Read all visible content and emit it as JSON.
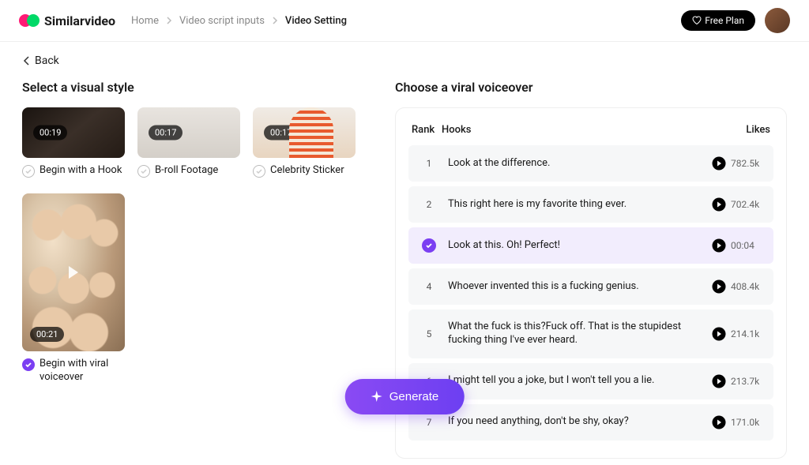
{
  "header": {
    "brand": "Similarvideo",
    "crumb_home": "Home",
    "crumb_inputs": "Video script inputs",
    "crumb_setting": "Video Setting",
    "free_plan": "Free Plan"
  },
  "back_label": "Back",
  "left": {
    "title": "Select a visual style",
    "styles": [
      {
        "duration": "00:19",
        "label": "Begin with a Hook"
      },
      {
        "duration": "00:17",
        "label": "B-roll Footage"
      },
      {
        "duration": "00:17",
        "label": "Celebrity Sticker"
      }
    ],
    "preview": {
      "duration": "00:21",
      "label": "Begin with viral voiceover"
    }
  },
  "right": {
    "title": "Choose a viral voiceover",
    "cols": {
      "rank": "Rank",
      "hooks": "Hooks",
      "likes": "Likes"
    },
    "rows": [
      {
        "rank": "1",
        "text": "Look at the difference.",
        "likes": "782.5k"
      },
      {
        "rank": "2",
        "text": "This right here is my favorite thing ever.",
        "likes": "702.4k"
      },
      {
        "rank": "3",
        "text": "Look at this. Oh! Perfect!",
        "likes": "00:04",
        "selected": true
      },
      {
        "rank": "4",
        "text": "Whoever invented this is a fucking genius.",
        "likes": "408.4k"
      },
      {
        "rank": "5",
        "text": "What the fuck is this?Fuck off. That is the stupidest fucking thing I've ever heard.",
        "likes": "214.1k"
      },
      {
        "rank": "6",
        "text": "I might tell you a joke, but I won't tell you a lie.",
        "likes": "213.7k"
      },
      {
        "rank": "7",
        "text": "If you need anything, don't be shy, okay?",
        "likes": "171.0k"
      }
    ]
  },
  "generate_label": "Generate"
}
